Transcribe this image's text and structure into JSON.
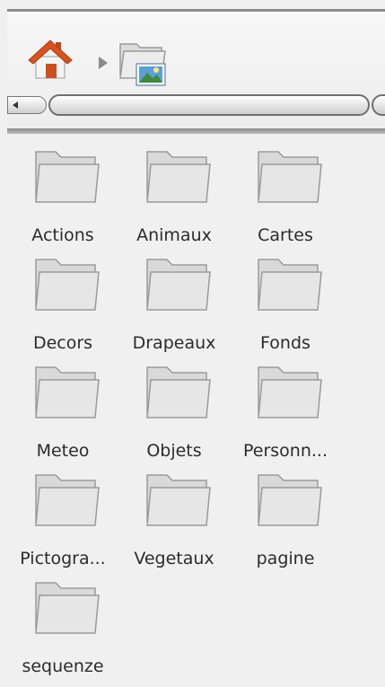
{
  "toolbar": {
    "home_icon": "home-icon",
    "breadcrumb_separator_icon": "chevron-right-icon",
    "breadcrumb_folder_icon": "picture-folder-icon"
  },
  "folders": [
    {
      "label": "Actions"
    },
    {
      "label": "Animaux"
    },
    {
      "label": "Cartes"
    },
    {
      "label": "Decors"
    },
    {
      "label": "Drapeaux"
    },
    {
      "label": "Fonds"
    },
    {
      "label": "Meteo"
    },
    {
      "label": "Objets"
    },
    {
      "label": "Personn..."
    },
    {
      "label": "Pictogra..."
    },
    {
      "label": "Vegetaux"
    },
    {
      "label": "pagine"
    },
    {
      "label": "sequenze"
    }
  ],
  "colors": {
    "background": "#f0f0f0",
    "folder_fill": "#e6e6e6",
    "folder_stroke": "#9a9a9a",
    "label_text": "#2b2b2b",
    "home_roof": "#d9531e",
    "home_wall": "#f2f2f2",
    "home_door": "#c9501f"
  }
}
